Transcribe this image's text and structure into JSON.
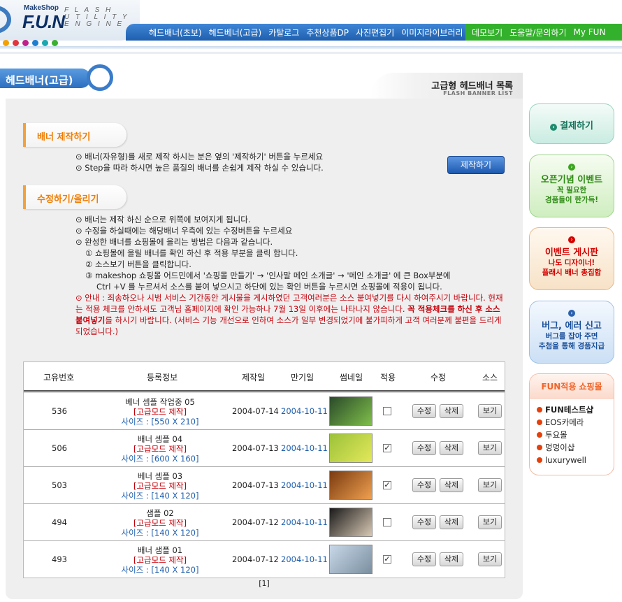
{
  "header": {
    "logo_makeshop": "MakeShop",
    "logo_fun": "F.U.N",
    "logo_sub": [
      "F L A S H",
      "U T I L I T Y",
      "E N  G I N E"
    ],
    "nav": [
      "헤드배너(초보)",
      "헤드베너(고급)",
      "카탈로그",
      "추천상품DP",
      "사진편집기",
      "이미지라이브러리"
    ],
    "nav_green": [
      "데모보기",
      "도움말/문의하기",
      "My FUN"
    ],
    "dot_colors": [
      "#f4a000",
      "#e2353c",
      "#c0208a",
      "#1e7fd1",
      "#18a8b0",
      "#3ab030"
    ]
  },
  "page_title": "헤드배너(고급)",
  "list_title": {
    "main": "고급형 헤드배너 목록",
    "sub": "FLASH BANNER LIST"
  },
  "make_section": {
    "tab": "배너 제작하기",
    "lines": [
      "⊙ 배너(자유형)를 새로 제작 하시는 분은 옆의 '제작하기' 버튼을 누르세요",
      "⊙ Step을 따라 하시면 높은 품질의 배너를 손쉽게 제작 하실 수 있습니다."
    ],
    "button": "제작하기"
  },
  "edit_section": {
    "tab": "수정하기/올리기",
    "lines": [
      "⊙ 배너는 제작 하신 순으로 위쪽에 보여지게 됩니다.",
      "⊙ 수정을 하실때에는 해당배너 우측에 있는 수정버튼을 누르세요",
      "⊙ 완성한 배너를 쇼핑몰에 올리는 방법은 다음과 같습니다.",
      "① 쇼핑몰에 올릴 배너를 확인 하신 후 적용 부분을 클릭 합니다.",
      "② 소스보기 버튼을 클릭합니다.",
      "③ makeshop 쇼핑몰 어드민에서 '쇼핑몰 만들기' → '인사말 메인 소개글' → '메인 소개글' 에 큰 Box부분에",
      "Ctrl +V 를 누르셔서 소스를 붙여 넣으시고 하단에 있는 확인 버튼을 누르시면 쇼핑몰에 적용이 됩니다."
    ],
    "notice_a": "⊙ 안내 : 죄송하오나 시범 서비스 기간동안 게시물을 게시하였던 고객여러분은 소스 붙여넣기를 다시 하여주시기 바랍니다. 현재는 적용 체크를 안하셔도 고객님 홈페이지에 확인 가능하나 7월 13일 이후에는 나타나지 않습니다.",
    "notice_bold": "꼭 적용체크를 하신 후 소스 붙여넣기",
    "notice_b": "를 하시기 바랍니다. (서비스 기능 개선으로 인하여 소스가 일부 변경되었기에 불가피하게 고객 여러분께 불편을 드리게 되었습니다.)"
  },
  "table": {
    "headers": [
      "고유번호",
      "등록정보",
      "제작일",
      "만기일",
      "썸네일",
      "적용",
      "수정",
      "소스"
    ],
    "edit_label": "수정",
    "delete_label": "삭제",
    "view_label": "보기",
    "rows": [
      {
        "id": "536",
        "name": "베너 셈플 작업중 05",
        "mode": "[고급모드 제작]",
        "size": "사이즈 : [550 X 210]",
        "made": "2004-07-14",
        "expire": "2004-10-11",
        "applied": false,
        "thumb": [
          "#2a4a2a",
          "#7fbf4a"
        ]
      },
      {
        "id": "506",
        "name": "배너 셈플 04",
        "mode": "[고급모드 제작]",
        "size": "사이즈 : [600 X 160]",
        "made": "2004-07-13",
        "expire": "2004-10-11",
        "applied": true,
        "thumb": [
          "#9bc23a",
          "#e4e85a"
        ]
      },
      {
        "id": "503",
        "name": "베너 셈플 03",
        "mode": "[고급모드 제작]",
        "size": "사이즈 : [140 X 120]",
        "made": "2004-07-13",
        "expire": "2004-10-11",
        "applied": true,
        "thumb": [
          "#7a3b10",
          "#f0a050"
        ]
      },
      {
        "id": "494",
        "name": "샘플 02",
        "mode": "[고급모드 제작]",
        "size": "사이즈 : [140 X 120]",
        "made": "2004-07-12",
        "expire": "2004-10-11",
        "applied": false,
        "thumb": [
          "#1a1a1a",
          "#d9c9b4"
        ]
      },
      {
        "id": "493",
        "name": "배너 샘플 01",
        "mode": "[고급모드 제작]",
        "size": "사이즈 : [140 X 120]",
        "made": "2004-07-12",
        "expire": "2004-10-11",
        "applied": true,
        "thumb": [
          "#c8d8e8",
          "#7a8fa0"
        ]
      }
    ],
    "pager": "[1]"
  },
  "side": {
    "pay": "결제하기",
    "open_title": "오픈기념 이벤트",
    "open_sub": [
      "꼭 필요한",
      "경품들이 한가득!"
    ],
    "event_title": "이벤트 게시판",
    "event_sub": [
      "나도 디자이너!",
      "플래시 배너 총집합"
    ],
    "bug_title": "버그, 에러 신고",
    "bug_sub": [
      "버그를 잡아 주면",
      "추첨을 통해 경품지급"
    ],
    "shop_title": "FUN적용 쇼핑몰",
    "shops": [
      "FUN테스트샵",
      "EOS카메라",
      "투요몰",
      "멍멍이샵",
      "luxurywell"
    ]
  }
}
